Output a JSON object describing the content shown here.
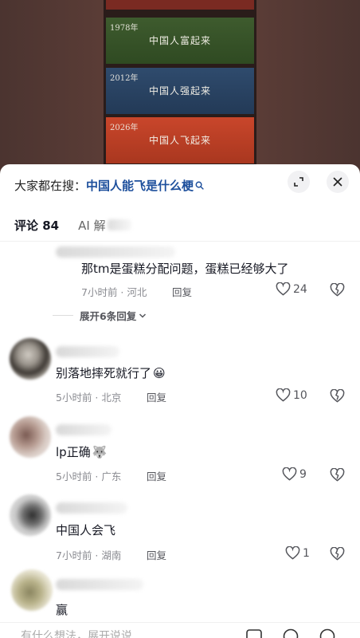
{
  "video": {
    "panels": [
      {
        "year": "1978年",
        "caption": "中国人富起来"
      },
      {
        "year": "2012年",
        "caption": "中国人强起来"
      },
      {
        "year": "2026年",
        "caption": "中国人飞起来"
      }
    ]
  },
  "search": {
    "prefix": "大家都在搜：",
    "query": "中国人能飞是什么梗"
  },
  "tabs": {
    "comments_label": "评论 84",
    "ai_label": "AI 解"
  },
  "comments": [
    {
      "text": "那tm是蛋糕分配问题，蛋糕已经够大了",
      "time_location": "7小时前 · 河北",
      "reply_label": "回复",
      "likes": "24",
      "expand_replies": "展开6条回复"
    },
    {
      "text": "别落地摔死就行了",
      "emoji": "😀",
      "time_location": "5小时前 · 北京",
      "reply_label": "回复",
      "likes": "10"
    },
    {
      "text": "lp正确",
      "emoji": "🐺",
      "time_location": "5小时前 · 广东",
      "reply_label": "回复",
      "likes": "9"
    },
    {
      "text": "中国人会飞",
      "time_location": "7小时前 · 湖南",
      "reply_label": "回复",
      "likes": "1"
    },
    {
      "text": "赢"
    }
  ],
  "input": {
    "placeholder": "有什么想法，展开说说"
  },
  "colors": {
    "link": "#1d4f9c",
    "text": "#161823",
    "meta": "#8a8b91"
  }
}
